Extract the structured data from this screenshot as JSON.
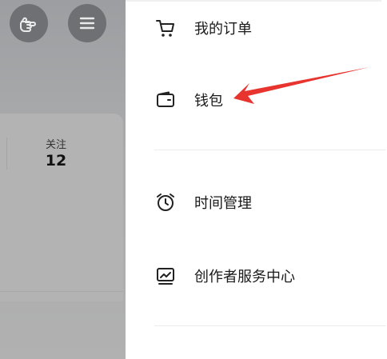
{
  "profile": {
    "stats": [
      {
        "label": "关注",
        "value": "12"
      }
    ]
  },
  "drawer": {
    "items": [
      {
        "label": "我的订单",
        "icon": "cart-icon"
      },
      {
        "label": "钱包",
        "icon": "wallet-icon"
      },
      {
        "label": "时间管理",
        "icon": "alarm-clock-icon"
      },
      {
        "label": "创作者服务中心",
        "icon": "creator-chart-icon"
      }
    ]
  },
  "colors": {
    "annotation_arrow": "#e8342f",
    "overlay": "#a7a8aa"
  }
}
